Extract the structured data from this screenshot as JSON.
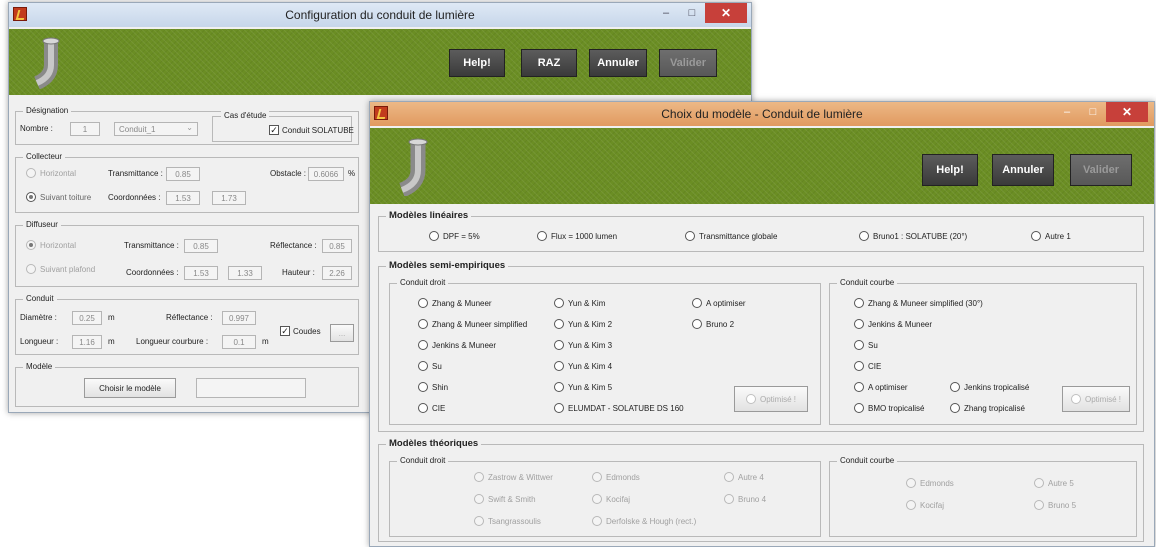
{
  "win1": {
    "title": "Configuration du conduit de lumière",
    "buttons": {
      "help": "Help!",
      "raz": "RAZ",
      "annuler": "Annuler",
      "valider": "Valider"
    },
    "designation": {
      "title": "Désignation",
      "nombre_label": "Nombre :",
      "nombre": "1",
      "name": "Conduit_1",
      "cas_title": "Cas d'étude",
      "cas_check": "Conduit SOLATUBE"
    },
    "collecteur": {
      "title": "Collecteur",
      "horizontal": "Horizontal",
      "toiture": "Suivant toiture",
      "trans_label": "Transmittance :",
      "trans": "0.85",
      "obst_label": "Obstacle :",
      "obst": "0.6066",
      "obst_unit": "%",
      "coord_label": "Coordonnées :",
      "c1": "1.53",
      "c2": "1.73"
    },
    "diffuseur": {
      "title": "Diffuseur",
      "horizontal": "Horizontal",
      "plafond": "Suivant plafond",
      "trans_label": "Transmittance :",
      "trans": "0.85",
      "refl_label": "Réflectance :",
      "refl": "0.85",
      "coord_label": "Coordonnées :",
      "c1": "1.53",
      "c2": "1.33",
      "haut_label": "Hauteur :",
      "haut": "2.26"
    },
    "conduit": {
      "title": "Conduit",
      "diam_label": "Diamètre :",
      "diam": "0.25",
      "diam_unit": "m",
      "refl_label": "Réflectance :",
      "refl": "0.997",
      "long_label": "Longueur :",
      "long": "1.16",
      "long_unit": "m",
      "lc_label": "Longueur courbure :",
      "lc": "0.1",
      "lc_unit": "m",
      "coudes": "Coudes",
      "dots": "..."
    },
    "modele": {
      "title": "Modèle",
      "choose": "Choisir le modèle",
      "value": ""
    }
  },
  "win2": {
    "title": "Choix du modèle - Conduit de lumière",
    "buttons": {
      "help": "Help!",
      "annuler": "Annuler",
      "valider": "Valider"
    },
    "lineaires": {
      "title": "Modèles linéaires",
      "items": [
        "DPF = 5%",
        "Flux = 1000 lumen",
        "Transmittance globale",
        "Bruno1 : SOLATUBE (20°)",
        "Autre 1"
      ]
    },
    "semi": {
      "title": "Modèles semi-empiriques",
      "droit_title": "Conduit droit",
      "col1": [
        "Zhang & Muneer",
        "Zhang & Muneer simplified",
        "Jenkins & Muneer",
        "Su",
        "Shin",
        "CIE"
      ],
      "col2": [
        "Yun & Kim",
        "Yun & Kim 2",
        "Yun & Kim 3",
        "Yun & Kim 4",
        "Yun & Kim 5",
        "ELUMDAT - SOLATUBE DS 160"
      ],
      "col3": [
        "A optimiser",
        "Bruno 2"
      ],
      "optimise": "Optimisé !",
      "courbe_title": "Conduit courbe",
      "courbe": [
        "Zhang & Muneer simplified (30°)",
        "Jenkins & Muneer",
        "Su",
        "CIE",
        "A optimiser",
        "Jenkins tropicalisé",
        "BMO tropicalisé",
        "Zhang tropicalisé"
      ],
      "optimise2": "Optimisé !"
    },
    "theo": {
      "title": "Modèles théoriques",
      "droit_title": "Conduit droit",
      "droit": [
        "Zastrow & Wittwer",
        "Edmonds",
        "Autre 4",
        "Swift & Smith",
        "Kocifaj",
        "Bruno 4",
        "Tsangrassoulis",
        "Derfolske & Hough (rect.)"
      ],
      "courbe_title": "Conduit courbe",
      "courbe": [
        "Edmonds",
        "Autre 5",
        "Kocifaj",
        "Bruno 5"
      ]
    }
  }
}
